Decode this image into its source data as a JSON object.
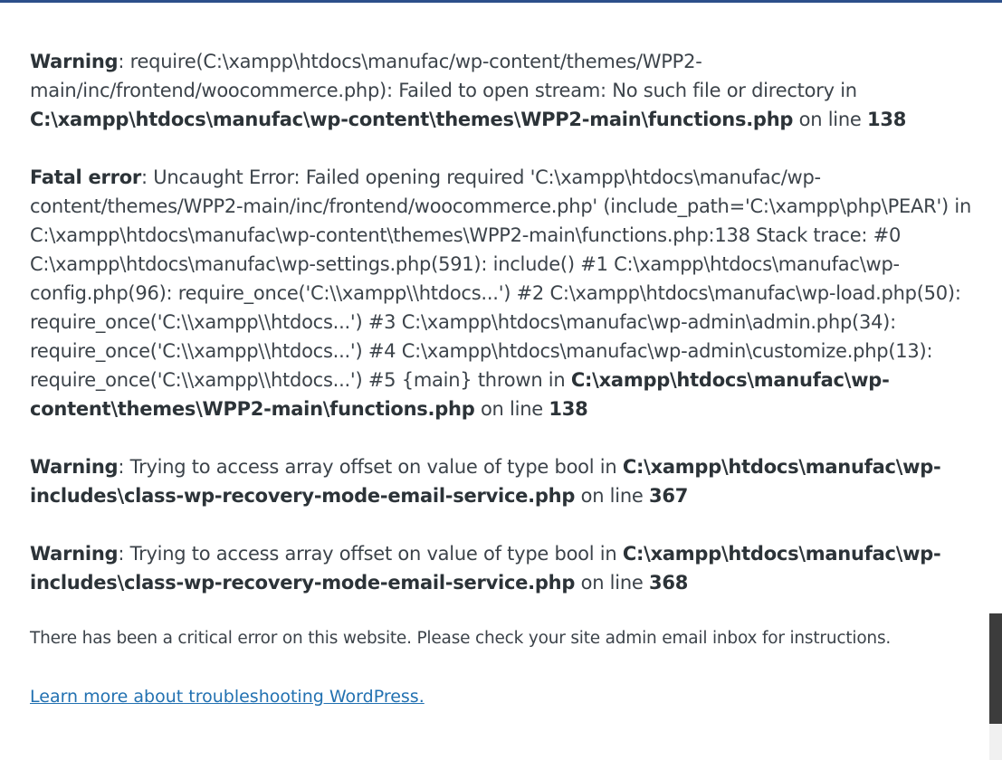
{
  "messages": [
    {
      "label": "Warning",
      "text1": ": require(C:\\xampp\\htdocs\\manufac/wp-content/themes/WPP2-main/inc/frontend/woocommerce.php): Failed to open stream: No such file or directory in ",
      "file": "C:\\xampp\\htdocs\\manufac\\wp-content\\themes\\WPP2-main\\functions.php",
      "on_line": " on line ",
      "line": "138"
    },
    {
      "label": "Fatal error",
      "text1": ": Uncaught Error: Failed opening required 'C:\\xampp\\htdocs\\manufac/wp-content/themes/WPP2-main/inc/frontend/woocommerce.php' (include_path='C:\\xampp\\php\\PEAR') in C:\\xampp\\htdocs\\manufac\\wp-content\\themes\\WPP2-main\\functions.php:138 Stack trace: #0 C:\\xampp\\htdocs\\manufac\\wp-settings.php(591): include() #1 C:\\xampp\\htdocs\\manufac\\wp-config.php(96): require_once('C:\\\\xampp\\\\htdocs...') #2 C:\\xampp\\htdocs\\manufac\\wp-load.php(50): require_once('C:\\\\xampp\\\\htdocs...') #3 C:\\xampp\\htdocs\\manufac\\wp-admin\\admin.php(34): require_once('C:\\\\xampp\\\\htdocs...') #4 C:\\xampp\\htdocs\\manufac\\wp-admin\\customize.php(13): require_once('C:\\\\xampp\\\\htdocs...') #5 {main} thrown in ",
      "file": "C:\\xampp\\htdocs\\manufac\\wp-content\\themes\\WPP2-main\\functions.php",
      "on_line": " on line ",
      "line": "138"
    },
    {
      "label": "Warning",
      "text1": ": Trying to access array offset on value of type bool in ",
      "file": "C:\\xampp\\htdocs\\manufac\\wp-includes\\class-wp-recovery-mode-email-service.php",
      "on_line": " on line ",
      "line": "367"
    },
    {
      "label": "Warning",
      "text1": ": Trying to access array offset on value of type bool in ",
      "file": "C:\\xampp\\htdocs\\manufac\\wp-includes\\class-wp-recovery-mode-email-service.php",
      "on_line": " on line ",
      "line": "368"
    }
  ],
  "die_message": "There has been a critical error on this website. Please check your site admin email inbox for instructions.",
  "help_link": "Learn more about troubleshooting WordPress.",
  "colors": {
    "text": "#3c434a",
    "link": "#2271b1",
    "top_border": "#2c4f8a"
  }
}
